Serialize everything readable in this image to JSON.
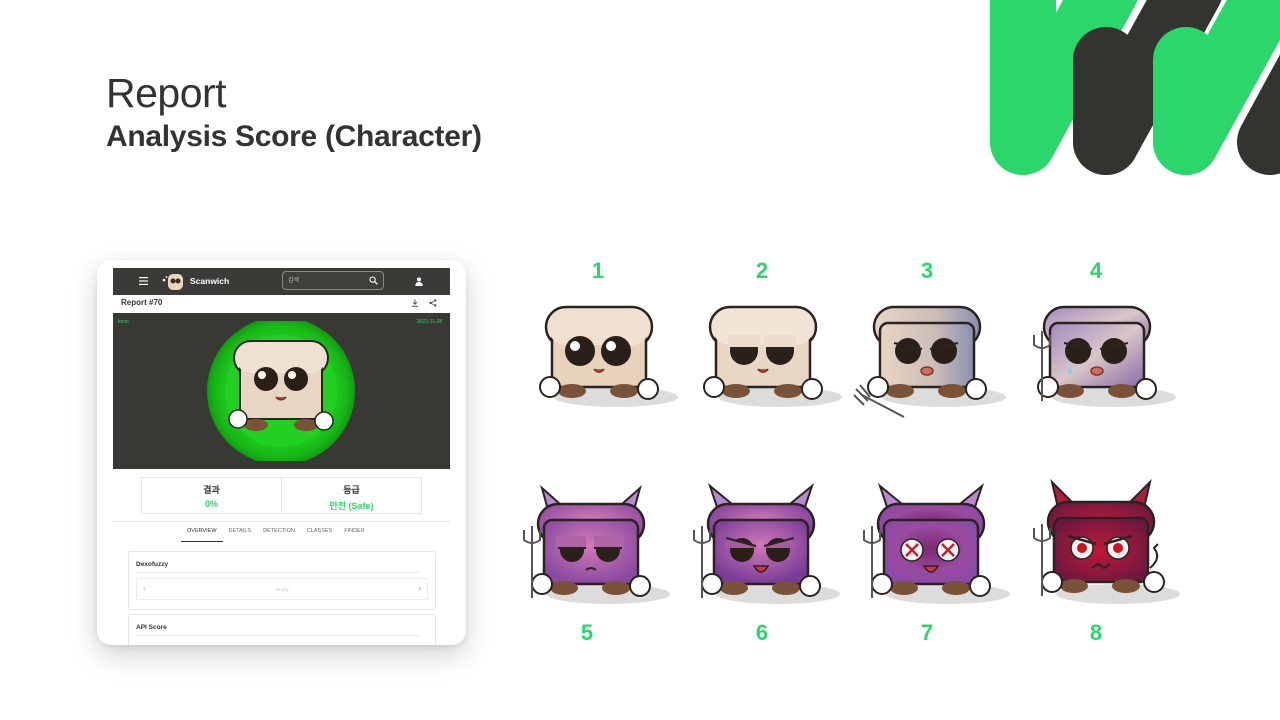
{
  "header": {
    "title": "Report",
    "subtitle": "Analysis Score (Character)"
  },
  "colors": {
    "accent_green": "#2bd66b",
    "dark": "#333330"
  },
  "phone": {
    "brand": "Scanwich",
    "search_placeholder": "검색",
    "report_title": "Report #70",
    "preview_left_label": "kmrs",
    "preview_date": "2023-11-28",
    "stats": [
      {
        "label": "결과",
        "value": "0%"
      },
      {
        "label": "등급",
        "value": "안전 (Safe)"
      }
    ],
    "tabs": [
      "OVERVIEW",
      "DETAILS",
      "DETECTION",
      "CLASSES",
      "FINDER"
    ],
    "active_tab": "OVERVIEW",
    "panels": [
      {
        "title": "Dexofuzzy",
        "pager_text": "Simply"
      },
      {
        "title": "API Score"
      }
    ],
    "icons": [
      "menu-icon",
      "search-icon",
      "user-icon",
      "download-icon",
      "share-icon"
    ]
  },
  "characters": [
    {
      "label": "1"
    },
    {
      "label": "2"
    },
    {
      "label": "3"
    },
    {
      "label": "4"
    },
    {
      "label": "5"
    },
    {
      "label": "6"
    },
    {
      "label": "7"
    },
    {
      "label": "8"
    }
  ]
}
